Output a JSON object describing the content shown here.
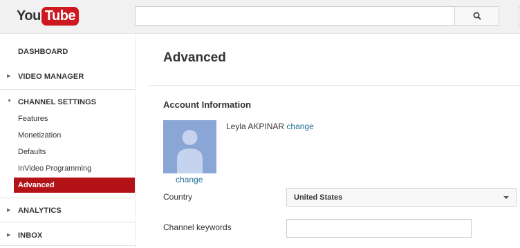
{
  "header": {
    "logo_you": "You",
    "logo_tube": "Tube",
    "search_placeholder": ""
  },
  "sidebar": {
    "dashboard": "DASHBOARD",
    "video_manager": "VIDEO MANAGER",
    "channel_settings": "CHANNEL SETTINGS",
    "sub_items": [
      "Features",
      "Monetization",
      "Defaults",
      "InVideo Programming",
      "Advanced"
    ],
    "analytics": "ANALYTICS",
    "inbox": "INBOX"
  },
  "main": {
    "title": "Advanced",
    "section_title": "Account Information",
    "account_name": "Leyla AKPINAR",
    "name_change_link": "change",
    "avatar_change_link": "change",
    "country_label": "Country",
    "country_value": "United States",
    "keywords_label": "Channel keywords",
    "keywords_value": ""
  },
  "colors": {
    "brand_red": "#cc181e",
    "active_nav": "#b31217",
    "link": "#1b6c92",
    "avatar_bg": "#8aa6d6"
  }
}
